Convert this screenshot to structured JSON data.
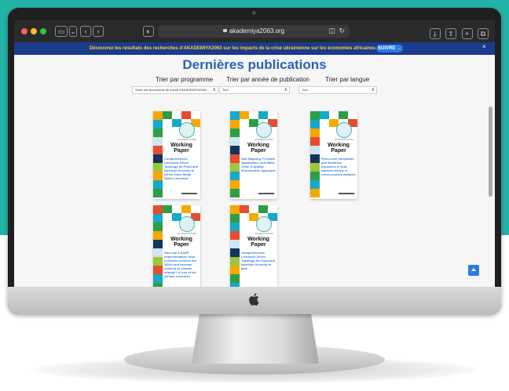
{
  "browser": {
    "url": "akademiya2063.org",
    "colors": {
      "close": "#ff5f57",
      "minimize": "#febc2e",
      "zoom": "#28c840"
    },
    "icons": [
      "sidebar-icon",
      "chevron-down-icon",
      "back-icon",
      "forward-icon",
      "shield-icon",
      "lock-icon",
      "reader-icon",
      "reload-icon",
      "download-icon",
      "share-icon",
      "new-tab-icon",
      "tabs-icon"
    ]
  },
  "banner": {
    "text": "Découvrez les résultats des recherches d'AKADEMIYA2063 sur les impacts de la crise ukrainienne sur les économies africaines",
    "button": "SUIVRE →",
    "close": "×"
  },
  "page": {
    "title": "Dernières publications",
    "filters": [
      {
        "label": "Trier par programme",
        "value": "Série des documents de travail d'AKADEMIYA2063"
      },
      {
        "label": "Trier par année de publication",
        "value": "Tout"
      },
      {
        "label": "Trier par langue",
        "value": "Tout"
      }
    ]
  },
  "cards": [
    {
      "org": "AKADEMIYA2063",
      "title": "Working Paper",
      "subtitle": "",
      "desc": "Comprehensive Livestock Driver Typology for Food and Nutrition Security in Africa Case Study Sister Livestock"
    },
    {
      "org": "AKADEMIYA2063",
      "title": "Working Paper",
      "subtitle": "",
      "desc": "Soil Mapping, Fertilizer Application, and Maize Yield: A Spatial Econometric Approach"
    },
    {
      "org": "AKADEMIYA2063",
      "title": "Working Paper",
      "subtitle": "",
      "desc": "Firm-Level Innovation and Business Dynamics in Sub-Saharan Africa: A cross-country analysis"
    },
    {
      "org": "AKADEMIYA2063",
      "title": "Working Paper",
      "subtitle": "",
      "desc": "How can CAADP implementation help countries achieve the SDGs and become resilient to climate change? A lens of six African countries"
    },
    {
      "org": "AKADEMIYA2063",
      "title": "Working Paper",
      "subtitle": "",
      "desc": "Comprehensive Livestock Driver Typology for Food and Nutrition Security in Mali"
    }
  ]
}
